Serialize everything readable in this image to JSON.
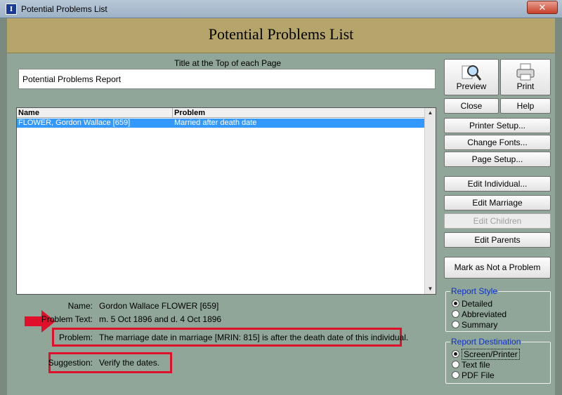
{
  "window": {
    "title": "Potential Problems List",
    "close_glyph": "✕"
  },
  "header": {
    "title": "Potential Problems List"
  },
  "page_title": {
    "label": "Title at the Top of each Page",
    "value": "Potential Problems Report"
  },
  "list": {
    "columns": [
      "Name",
      "Problem"
    ],
    "rows": [
      {
        "name": "FLOWER, Gordon Wallace [659]",
        "problem": "Married after death date"
      }
    ]
  },
  "details": {
    "name_label": "Name:",
    "name_value": "Gordon Wallace FLOWER [659]",
    "problem_text_label": "Problem Text:",
    "problem_text_value": "m. 5 Oct 1896 and d. 4 Oct 1896",
    "problem_label": "Problem:",
    "problem_value": "The marriage date in marriage [MRIN: 815] is after the death date of this individual.",
    "suggestion_label": "Suggestion:",
    "suggestion_value": "Verify the dates."
  },
  "buttons": {
    "preview": "Preview",
    "print": "Print",
    "close": "Close",
    "help": "Help",
    "printer_setup": "Printer Setup...",
    "change_fonts": "Change Fonts...",
    "page_setup": "Page Setup...",
    "edit_individual": "Edit Individual...",
    "edit_marriage": "Edit Marriage",
    "edit_children": "Edit Children",
    "edit_parents": "Edit Parents",
    "mark_not_problem": "Mark as Not a Problem"
  },
  "report_style": {
    "title": "Report Style",
    "options": [
      "Detailed",
      "Abbreviated",
      "Summary"
    ],
    "selected": "Detailed"
  },
  "report_destination": {
    "title": "Report Destination",
    "options": [
      "Screen/Printer",
      "Text file",
      "PDF File"
    ],
    "selected": "Screen/Printer"
  },
  "colors": {
    "header_band": "#b5a56a",
    "body": "#8fa699",
    "selection": "#3399ff",
    "annotation_red": "#e0102a",
    "group_title": "#0a30d0"
  }
}
